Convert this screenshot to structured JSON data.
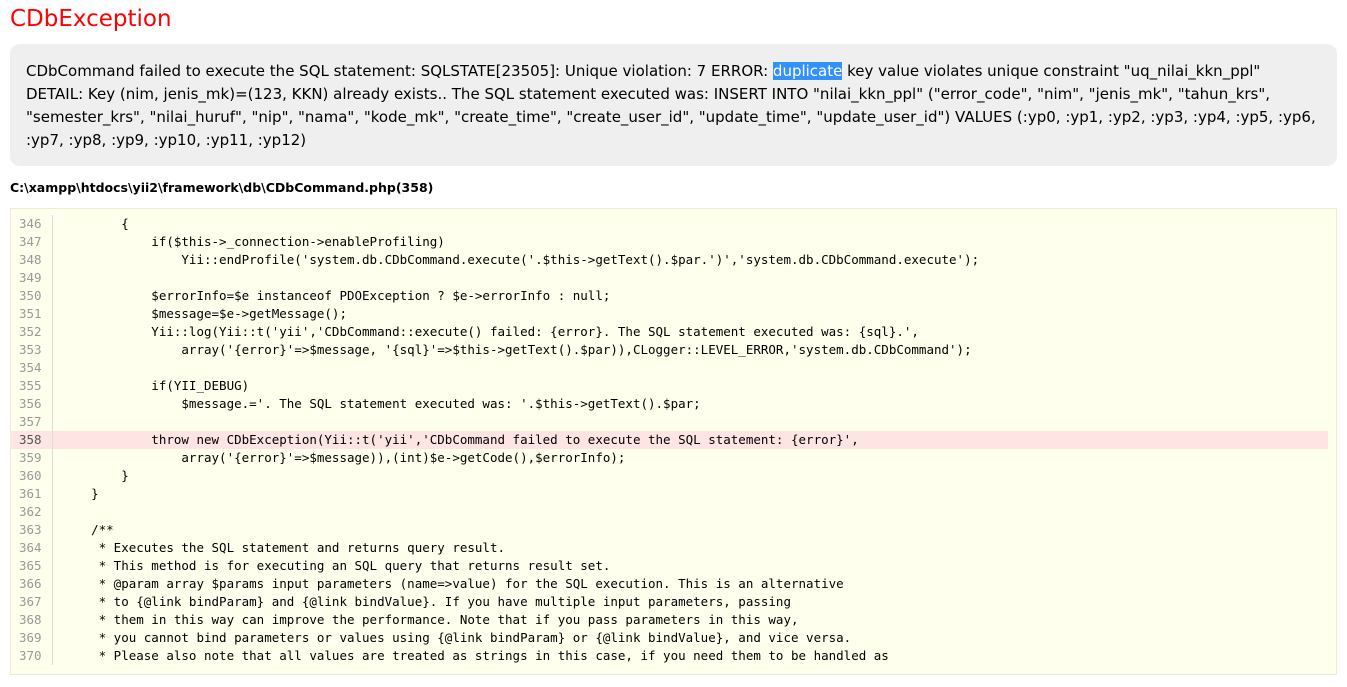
{
  "exception_title": "CDbException",
  "message": {
    "before_highlight": "CDbCommand failed to execute the SQL statement: SQLSTATE[23505]: Unique violation: 7 ERROR: ",
    "highlight": "duplicate",
    "after_highlight": " key value violates unique constraint \"uq_nilai_kkn_ppl\" DETAIL: Key (nim, jenis_mk)=(123, KKN) already exists.. The SQL statement executed was: INSERT INTO \"nilai_kkn_ppl\" (\"error_code\", \"nim\", \"jenis_mk\", \"tahun_krs\", \"semester_krs\", \"nilai_huruf\", \"nip\", \"nama\", \"kode_mk\", \"create_time\", \"create_user_id\", \"update_time\", \"update_user_id\") VALUES (:yp0, :yp1, :yp2, :yp3, :yp4, :yp5, :yp6, :yp7, :yp8, :yp9, :yp10, :yp11, :yp12)"
  },
  "source_file": "C:\\xampp\\htdocs\\yii2\\framework\\db\\CDbCommand.php(358)",
  "error_line": 358,
  "code_lines": [
    {
      "num": "346",
      "text": "        {"
    },
    {
      "num": "347",
      "text": "            if($this->_connection->enableProfiling)"
    },
    {
      "num": "348",
      "text": "                Yii::endProfile('system.db.CDbCommand.execute('.$this->getText().$par.')','system.db.CDbCommand.execute');"
    },
    {
      "num": "349",
      "text": ""
    },
    {
      "num": "350",
      "text": "            $errorInfo=$e instanceof PDOException ? $e->errorInfo : null;"
    },
    {
      "num": "351",
      "text": "            $message=$e->getMessage();"
    },
    {
      "num": "352",
      "text": "            Yii::log(Yii::t('yii','CDbCommand::execute() failed: {error}. The SQL statement executed was: {sql}.',"
    },
    {
      "num": "353",
      "text": "                array('{error}'=>$message, '{sql}'=>$this->getText().$par)),CLogger::LEVEL_ERROR,'system.db.CDbCommand');"
    },
    {
      "num": "354",
      "text": ""
    },
    {
      "num": "355",
      "text": "            if(YII_DEBUG)"
    },
    {
      "num": "356",
      "text": "                $message.='. The SQL statement executed was: '.$this->getText().$par;"
    },
    {
      "num": "357",
      "text": ""
    },
    {
      "num": "358",
      "text": "            throw new CDbException(Yii::t('yii','CDbCommand failed to execute the SQL statement: {error}',"
    },
    {
      "num": "359",
      "text": "                array('{error}'=>$message)),(int)$e->getCode(),$errorInfo);"
    },
    {
      "num": "360",
      "text": "        }"
    },
    {
      "num": "361",
      "text": "    }"
    },
    {
      "num": "362",
      "text": ""
    },
    {
      "num": "363",
      "text": "    /**"
    },
    {
      "num": "364",
      "text": "     * Executes the SQL statement and returns query result."
    },
    {
      "num": "365",
      "text": "     * This method is for executing an SQL query that returns result set."
    },
    {
      "num": "366",
      "text": "     * @param array $params input parameters (name=>value) for the SQL execution. This is an alternative"
    },
    {
      "num": "367",
      "text": "     * to {@link bindParam} and {@link bindValue}. If you have multiple input parameters, passing"
    },
    {
      "num": "368",
      "text": "     * them in this way can improve the performance. Note that if you pass parameters in this way,"
    },
    {
      "num": "369",
      "text": "     * you cannot bind parameters or values using {@link bindParam} or {@link bindValue}, and vice versa."
    },
    {
      "num": "370",
      "text": "     * Please also note that all values are treated as strings in this case, if you need them to be handled as"
    }
  ],
  "colors": {
    "title": "#ff0000",
    "message_bg": "#efefef",
    "selection": "#3390ff",
    "code_bg": "#ffffee",
    "error_line_bg": "#ffe4e4"
  }
}
